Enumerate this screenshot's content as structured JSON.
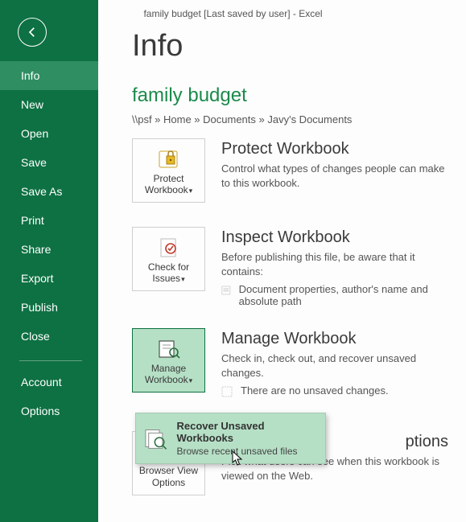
{
  "window": {
    "title": "family budget [Last saved by user] - Excel"
  },
  "sidebar": {
    "items": [
      {
        "label": "Info",
        "selected": true
      },
      {
        "label": "New"
      },
      {
        "label": "Open"
      },
      {
        "label": "Save"
      },
      {
        "label": "Save As"
      },
      {
        "label": "Print"
      },
      {
        "label": "Share"
      },
      {
        "label": "Export"
      },
      {
        "label": "Publish"
      },
      {
        "label": "Close"
      }
    ],
    "footer": [
      {
        "label": "Account"
      },
      {
        "label": "Options"
      }
    ]
  },
  "page": {
    "title": "Info",
    "doc_title": "family budget",
    "breadcrumb": "\\\\psf » Home » Documents » Javy's Documents"
  },
  "protect": {
    "tile_line1": "Protect",
    "tile_line2": "Workbook",
    "heading": "Protect Workbook",
    "desc": "Control what types of changes people can make to this workbook."
  },
  "inspect": {
    "tile_line1": "Check for",
    "tile_line2": "Issues",
    "heading": "Inspect Workbook",
    "desc": "Before publishing this file, be aware that it contains:",
    "bullet": "Document properties, author's name and absolute path"
  },
  "manage": {
    "tile_line1": "Manage",
    "tile_line2": "Workbook",
    "heading": "Manage Workbook",
    "desc": "Check in, check out, and recover unsaved changes.",
    "bullet": "There are no unsaved changes.",
    "menu_item_title": "Recover Unsaved Workbooks",
    "menu_item_desc": "Browse recent unsaved files"
  },
  "browser": {
    "tile_line1": "Browser View",
    "tile_line2": "Options",
    "heading_tail": "ptions",
    "desc": "Pick what users can see when this workbook is viewed on the Web."
  }
}
